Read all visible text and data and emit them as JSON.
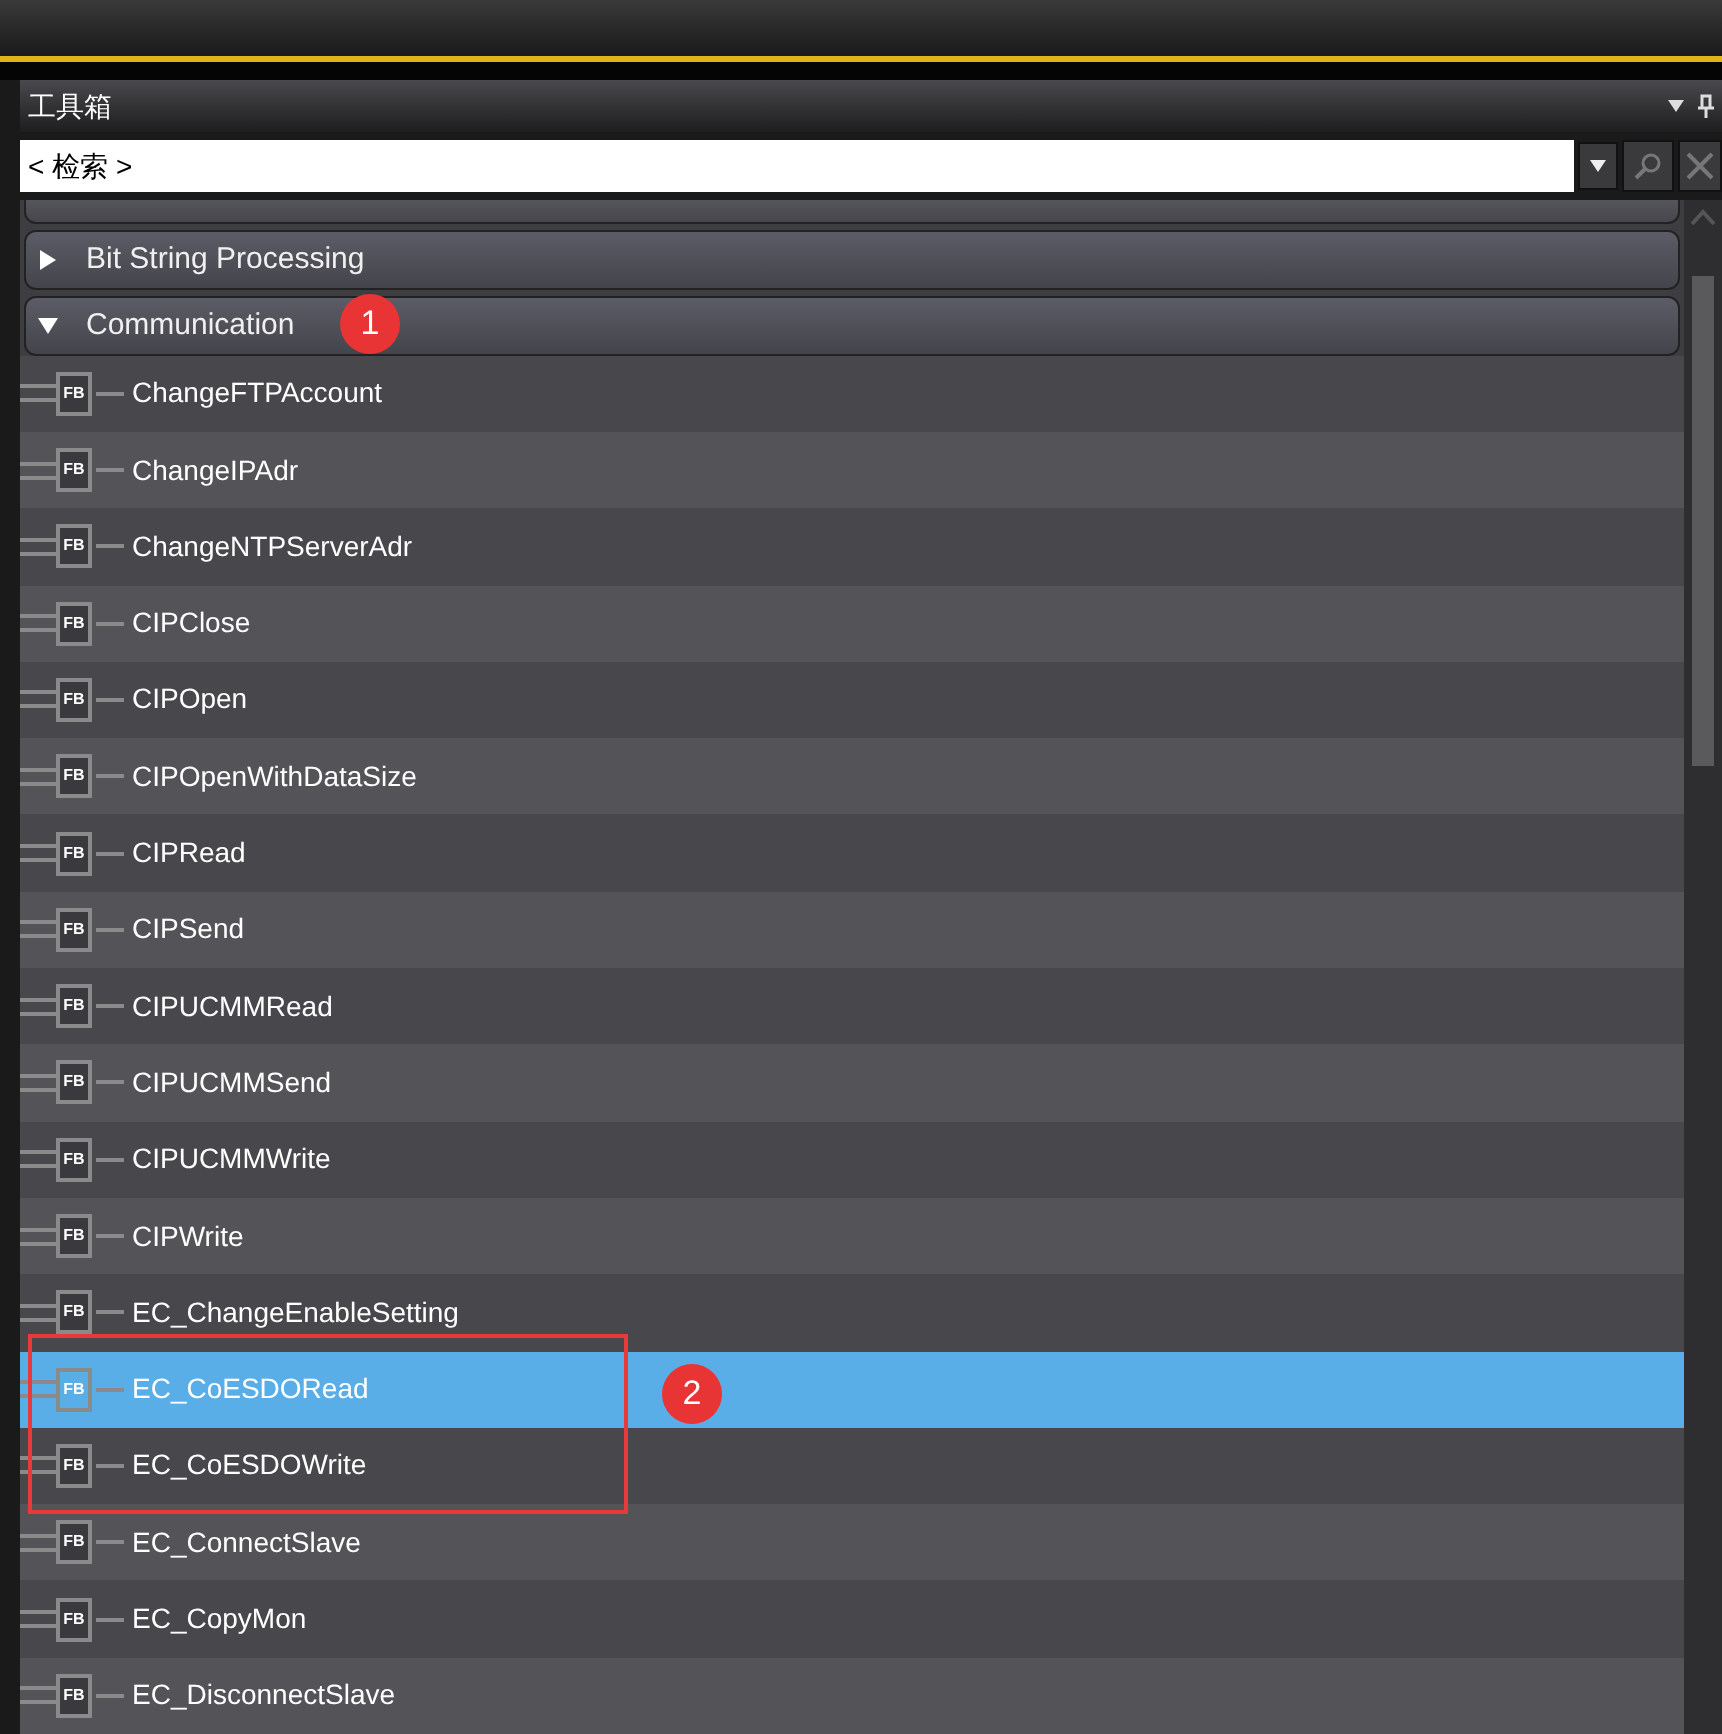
{
  "panel": {
    "title": "工具箱",
    "search": {
      "value": "< 检索 >"
    }
  },
  "groups": [
    {
      "label": "Bit String Processing",
      "expanded": false
    },
    {
      "label": "Communication",
      "expanded": true
    }
  ],
  "items": [
    {
      "tag": "FB",
      "label": "ChangeFTPAccount",
      "selected": false
    },
    {
      "tag": "FB",
      "label": "ChangeIPAdr",
      "selected": false
    },
    {
      "tag": "FB",
      "label": "ChangeNTPServerAdr",
      "selected": false
    },
    {
      "tag": "FB",
      "label": "CIPClose",
      "selected": false
    },
    {
      "tag": "FB",
      "label": "CIPOpen",
      "selected": false
    },
    {
      "tag": "FB",
      "label": "CIPOpenWithDataSize",
      "selected": false
    },
    {
      "tag": "FB",
      "label": "CIPRead",
      "selected": false
    },
    {
      "tag": "FB",
      "label": "CIPSend",
      "selected": false
    },
    {
      "tag": "FB",
      "label": "CIPUCMMRead",
      "selected": false
    },
    {
      "tag": "FB",
      "label": "CIPUCMMSend",
      "selected": false
    },
    {
      "tag": "FB",
      "label": "CIPUCMMWrite",
      "selected": false
    },
    {
      "tag": "FB",
      "label": "CIPWrite",
      "selected": false
    },
    {
      "tag": "FB",
      "label": "EC_ChangeEnableSetting",
      "selected": false
    },
    {
      "tag": "FB",
      "label": "EC_CoESDORead",
      "selected": true
    },
    {
      "tag": "FB",
      "label": "EC_CoESDOWrite",
      "selected": false
    },
    {
      "tag": "FB",
      "label": "EC_ConnectSlave",
      "selected": false
    },
    {
      "tag": "FB",
      "label": "EC_CopyMon",
      "selected": false
    },
    {
      "tag": "FB",
      "label": "EC_DisconnectSlave",
      "selected": false
    }
  ],
  "annotations": [
    {
      "label": "1"
    },
    {
      "label": "2"
    }
  ]
}
